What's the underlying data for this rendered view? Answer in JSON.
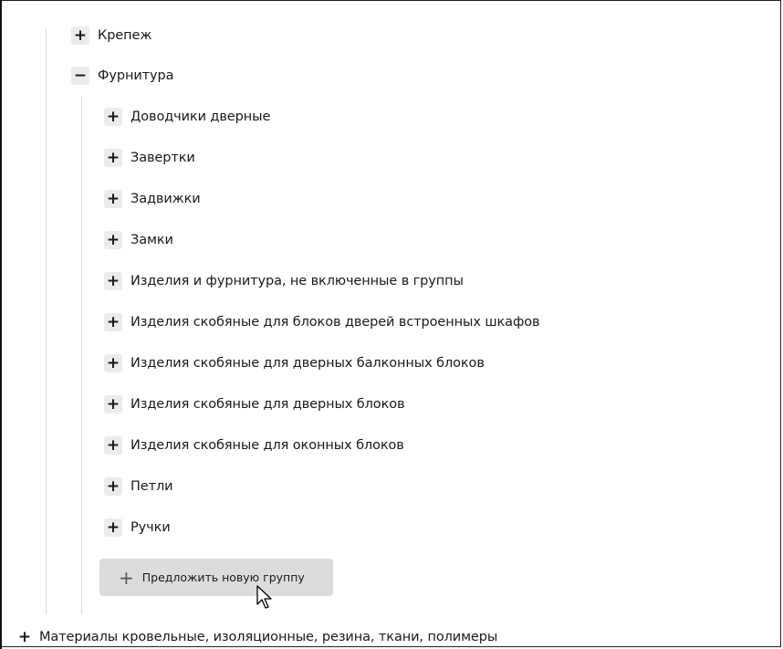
{
  "tree": {
    "level1_item": {
      "label": "Крепеж",
      "toggle": "+"
    },
    "level1_expanded": {
      "label": "Фурнитура",
      "toggle": "−"
    },
    "children": [
      {
        "label": "Доводчики дверные",
        "toggle": "+"
      },
      {
        "label": "Завертки",
        "toggle": "+"
      },
      {
        "label": "Задвижки",
        "toggle": "+"
      },
      {
        "label": "Замки",
        "toggle": "+"
      },
      {
        "label": "Изделия и фурнитура, не включенные в группы",
        "toggle": "+"
      },
      {
        "label": "Изделия скобяные для блоков дверей встроенных шкафов",
        "toggle": "+"
      },
      {
        "label": "Изделия скобяные для дверных балконных блоков",
        "toggle": "+"
      },
      {
        "label": "Изделия скобяные для дверных блоков",
        "toggle": "+"
      },
      {
        "label": "Изделия скобяные для оконных блоков",
        "toggle": "+"
      },
      {
        "label": "Петли",
        "toggle": "+"
      },
      {
        "label": "Ручки",
        "toggle": "+"
      }
    ],
    "suggest_button": {
      "label": "Предложить новую группу",
      "icon": "plus-icon"
    },
    "root_item": {
      "label": "Материалы кровельные, изоляционные, резина, ткани, полимеры",
      "toggle": "+"
    }
  },
  "colors": {
    "toggle_bg": "#ececec",
    "button_bg": "#dcdcdc",
    "tree_line": "#dcdcdc"
  }
}
